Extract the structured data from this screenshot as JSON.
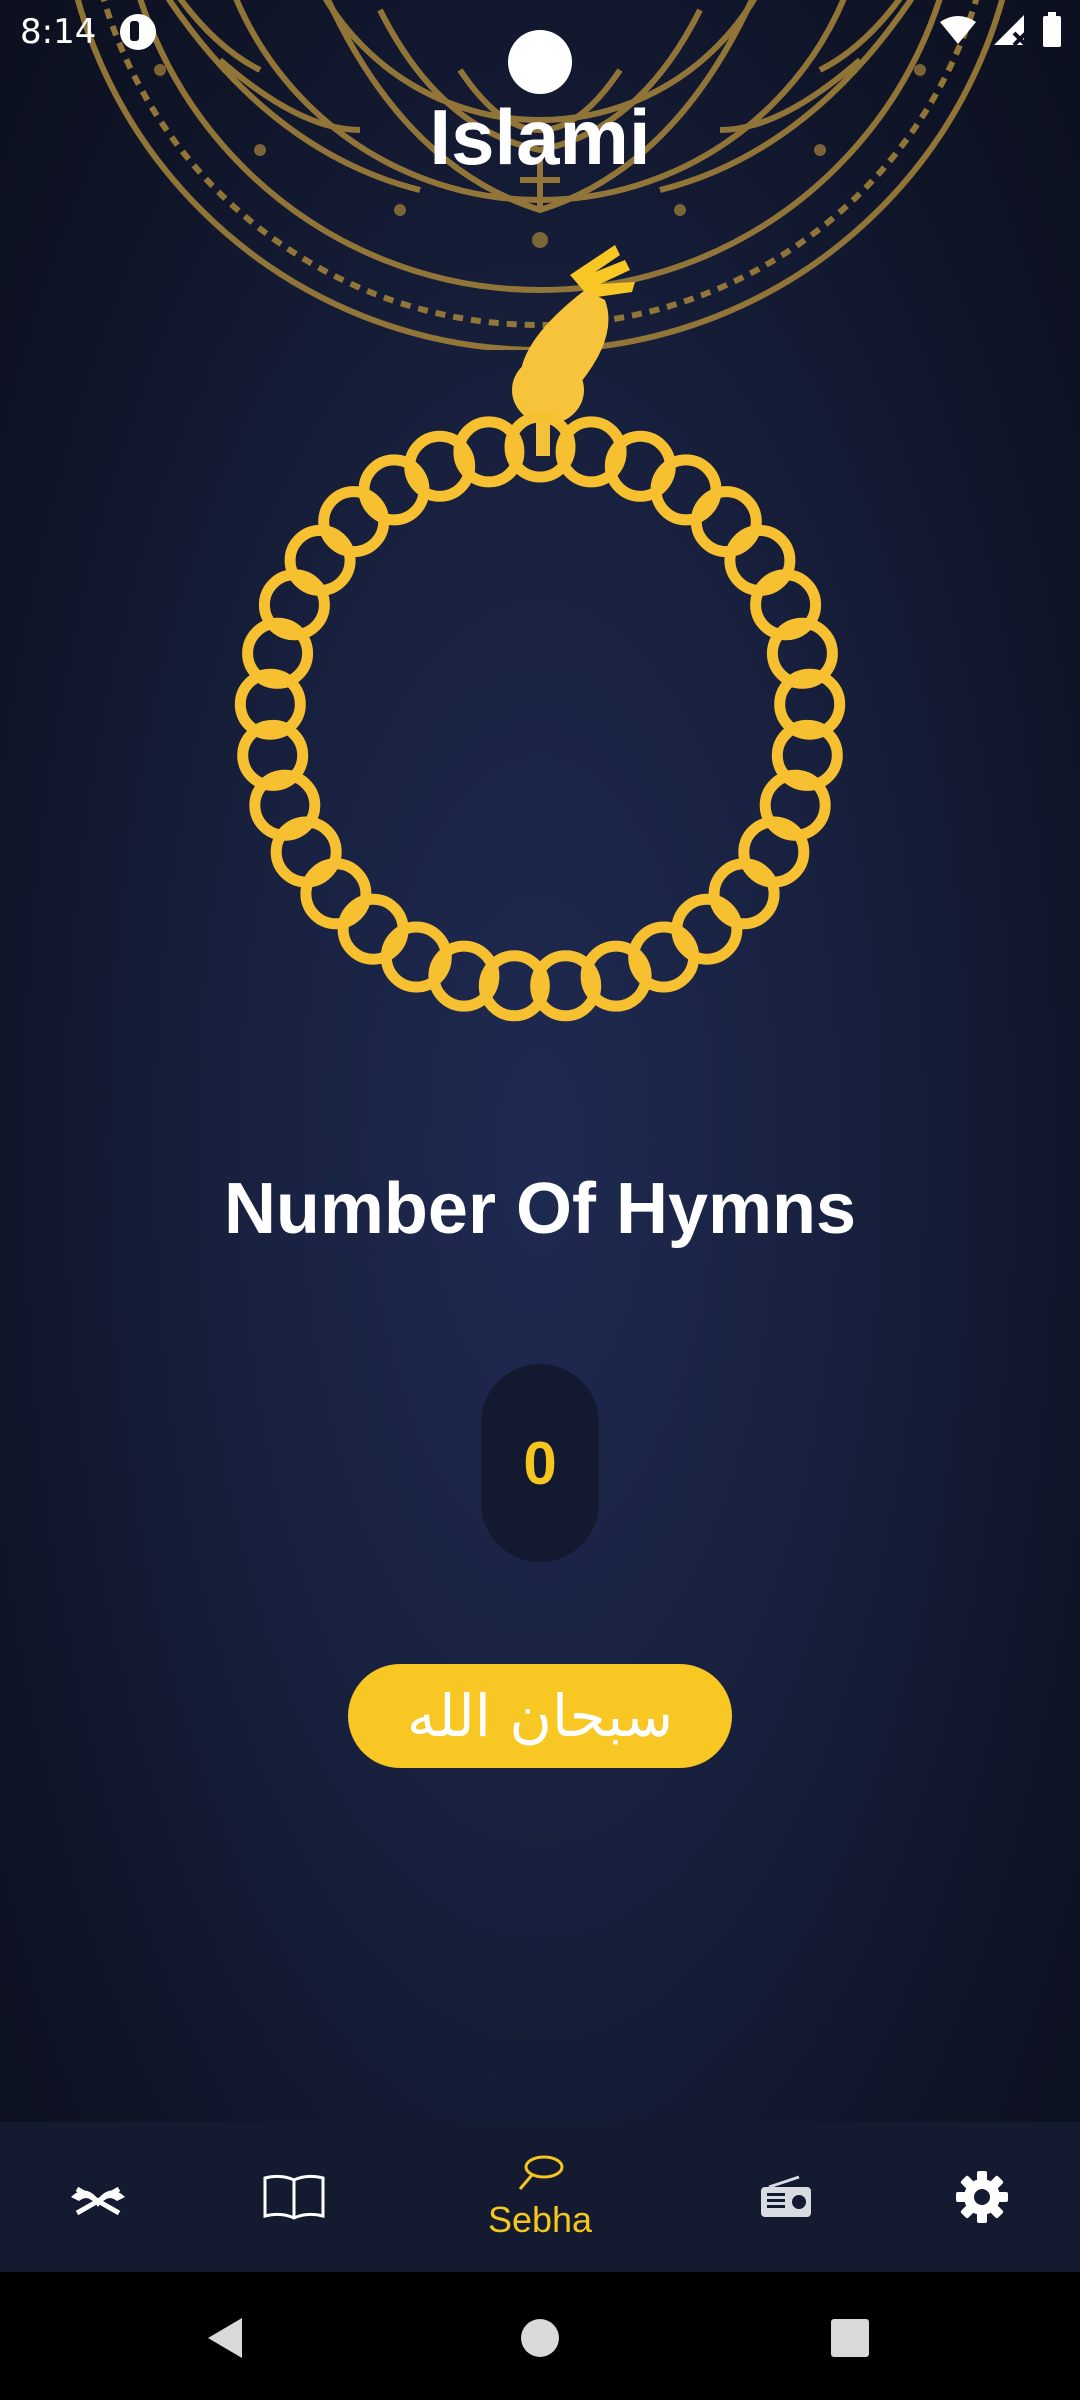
{
  "status_bar": {
    "time": "8:14",
    "icons": [
      "wifi-icon",
      "signal-icon",
      "battery-icon"
    ]
  },
  "app": {
    "title": "Islami"
  },
  "sebha_screen": {
    "hymns_label": "Number Of Hymns",
    "counter": "0",
    "tasbih_label": "سبحان الله"
  },
  "bottom_nav": {
    "items": [
      {
        "id": "quran",
        "icon": "quran-icon",
        "label": ""
      },
      {
        "id": "hadith",
        "icon": "book-icon",
        "label": ""
      },
      {
        "id": "sebha",
        "icon": "sebha-icon",
        "label": "Sebha"
      },
      {
        "id": "radio",
        "icon": "radio-icon",
        "label": ""
      },
      {
        "id": "settings",
        "icon": "gear-icon",
        "label": ""
      }
    ],
    "active": "sebha"
  },
  "colors": {
    "accent": "#f8c724",
    "background": "#18213f",
    "nav_background": "#141a30",
    "mandala": "#a8863a"
  }
}
